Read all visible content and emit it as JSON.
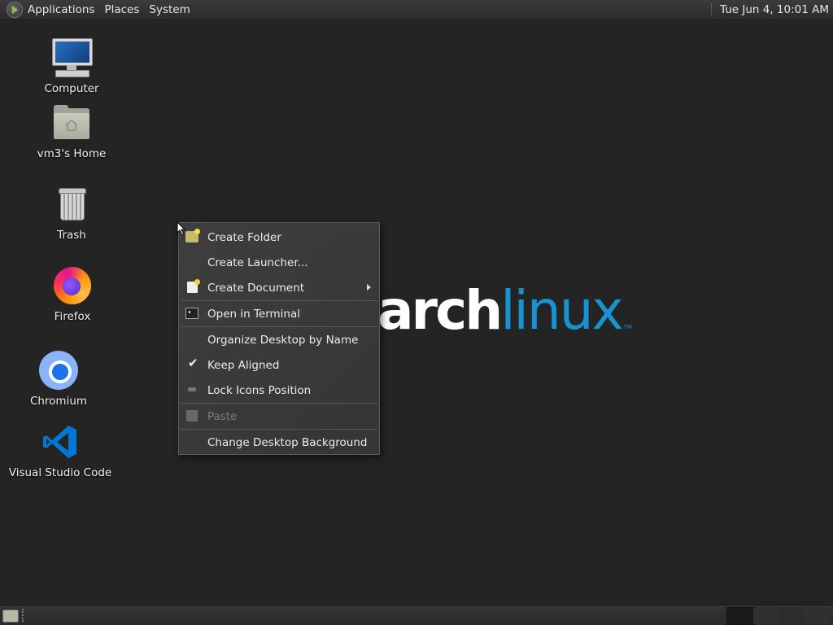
{
  "top_panel": {
    "menus": [
      "Applications",
      "Places",
      "System"
    ],
    "clock": "Tue Jun  4, 10:01 AM"
  },
  "desktop_icons": [
    {
      "label": "Computer",
      "icon": "computer-icon"
    },
    {
      "label": "vm3's Home",
      "icon": "home-folder-icon"
    },
    {
      "label": "Trash",
      "icon": "trash-icon"
    },
    {
      "label": "Firefox",
      "icon": "firefox-icon"
    },
    {
      "label": "Chromium",
      "icon": "chromium-icon"
    },
    {
      "label": "Visual Studio Code",
      "icon": "vscode-icon"
    }
  ],
  "wallpaper": {
    "logo_part1": "arch",
    "logo_part2": "linux",
    "logo_tm": "TM",
    "accent_color": "#1793d1"
  },
  "context_menu": {
    "items": [
      {
        "label": "Create Folder",
        "icon": "folder-new-icon",
        "enabled": true
      },
      {
        "label": "Create Launcher...",
        "enabled": true
      },
      {
        "label": "Create Document",
        "icon": "document-new-icon",
        "submenu": true,
        "enabled": true
      },
      {
        "label": "Open in Terminal",
        "icon": "terminal-icon",
        "enabled": true
      },
      {
        "label": "Organize Desktop by Name",
        "enabled": true
      },
      {
        "label": "Keep Aligned",
        "checked": true,
        "enabled": true
      },
      {
        "label": "Lock Icons Position",
        "icon": "lock-icon",
        "enabled": true
      },
      {
        "label": "Paste",
        "icon": "paste-icon",
        "enabled": false
      },
      {
        "label": "Change Desktop Background",
        "enabled": true
      }
    ]
  }
}
